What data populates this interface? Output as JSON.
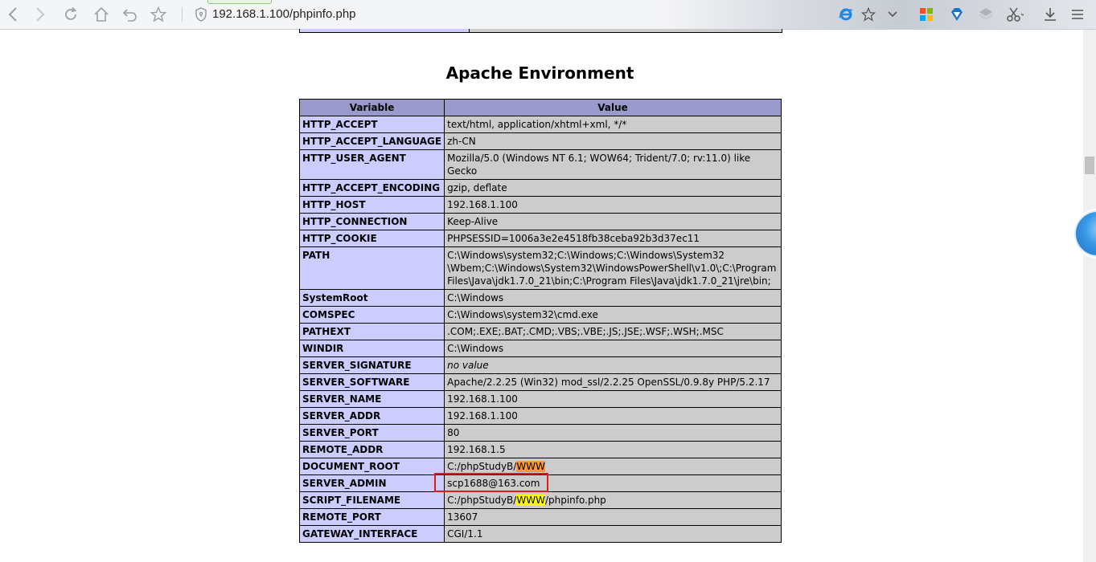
{
  "browser": {
    "url": "192.168.1.100/phpinfo.php",
    "icons": [
      "back-icon",
      "forward-icon",
      "refresh-icon",
      "home-icon",
      "undo-icon",
      "favorite-star-icon",
      "security-shield-icon",
      "ie-mode-icon",
      "bookmark-star-icon",
      "dropdown-chevron-icon",
      "apps-grid-icon",
      "shield-diamond-icon",
      "cube-icon",
      "scissors-icon",
      "download-icon",
      "menu-icon"
    ]
  },
  "section": {
    "title": "Apache Environment",
    "col_variable": "Variable",
    "col_value": "Value"
  },
  "rows": [
    {
      "k": "HTTP_ACCEPT",
      "v": "text/html, application/xhtml+xml, */*"
    },
    {
      "k": "HTTP_ACCEPT_LANGUAGE",
      "v": "zh-CN"
    },
    {
      "k": "HTTP_USER_AGENT",
      "v": "Mozilla/5.0 (Windows NT 6.1; WOW64; Trident/7.0; rv:11.0) like Gecko"
    },
    {
      "k": "HTTP_ACCEPT_ENCODING",
      "v": "gzip, deflate"
    },
    {
      "k": "HTTP_HOST",
      "v": "192.168.1.100"
    },
    {
      "k": "HTTP_CONNECTION",
      "v": "Keep-Alive"
    },
    {
      "k": "HTTP_COOKIE",
      "v": "PHPSESSID=1006a3e2e4518fb38ceba92b3d37ec11"
    },
    {
      "k": "PATH",
      "v1": "C:\\Windows\\system32;C:\\Windows;C:\\Windows\\System32",
      "v2": "\\Wbem;C:\\Windows\\System32\\WindowsPowerShell\\v1.0\\;C:\\Program",
      "v3": "Files\\Java\\jdk1.7.0_21\\bin;C:\\Program Files\\Java\\jdk1.7.0_21\\jre\\bin;"
    },
    {
      "k": "SystemRoot",
      "v": "C:\\Windows"
    },
    {
      "k": "COMSPEC",
      "v": "C:\\Windows\\system32\\cmd.exe"
    },
    {
      "k": "PATHEXT",
      "v": ".COM;.EXE;.BAT;.CMD;.VBS;.VBE;.JS;.JSE;.WSF;.WSH;.MSC"
    },
    {
      "k": "WINDIR",
      "v": "C:\\Windows"
    },
    {
      "k": "SERVER_SIGNATURE",
      "v": "no value"
    },
    {
      "k": "SERVER_SOFTWARE",
      "v": "Apache/2.2.25 (Win32) mod_ssl/2.2.25 OpenSSL/0.9.8y PHP/5.2.17"
    },
    {
      "k": "SERVER_NAME",
      "v": "192.168.1.100"
    },
    {
      "k": "SERVER_ADDR",
      "v": "192.168.1.100"
    },
    {
      "k": "SERVER_PORT",
      "v": "80"
    },
    {
      "k": "REMOTE_ADDR",
      "v": "192.168.1.5"
    },
    {
      "k": "DOCUMENT_ROOT",
      "v_prefix": "C:/phpStudyB/",
      "v_hl": "WWW"
    },
    {
      "k": "SERVER_ADMIN",
      "v": "scp1688@163.com"
    },
    {
      "k": "SCRIPT_FILENAME",
      "v_prefix": "C:/phpStudyB/",
      "v_hl": "WWW",
      "v_suffix": "/phpinfo.php"
    },
    {
      "k": "REMOTE_PORT",
      "v": "13607"
    },
    {
      "k": "GATEWAY_INTERFACE",
      "v": "CGI/1.1"
    }
  ],
  "colors": {
    "header_bg": "#9999cc",
    "key_bg": "#ccccff",
    "value_bg": "#cccccc",
    "highlight_box": "#e21b1b",
    "highlight_orange": "#ff9933",
    "highlight_yellow": "#ffff00"
  }
}
